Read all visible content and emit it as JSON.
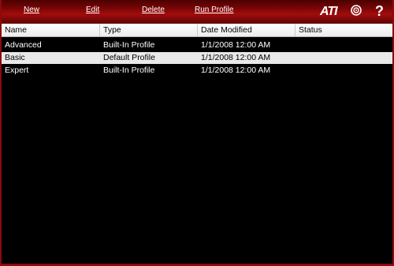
{
  "toolbar": {
    "new_label": "New",
    "edit_label": "Edit",
    "delete_label": "Delete",
    "run_profile_label": "Run Profile",
    "logo_text": "ATI",
    "help_label": "?"
  },
  "table": {
    "columns": [
      "Name",
      "Type",
      "Date Modified",
      "Status"
    ],
    "rows": [
      {
        "name": "Advanced",
        "type": "Built-In Profile",
        "date": "1/1/2008 12:00 AM",
        "status": ""
      },
      {
        "name": "Basic",
        "type": "Default Profile",
        "date": "1/1/2008 12:00 AM",
        "status": ""
      },
      {
        "name": "Expert",
        "type": "Built-In Profile",
        "date": "1/1/2008 12:00 AM",
        "status": ""
      }
    ],
    "selected_row": 1
  },
  "colors": {
    "toolbar_red": "#a10d0d",
    "background": "#000000",
    "selected_row": "#e9e9e9"
  },
  "icons": [
    "target-icon",
    "help-icon"
  ]
}
